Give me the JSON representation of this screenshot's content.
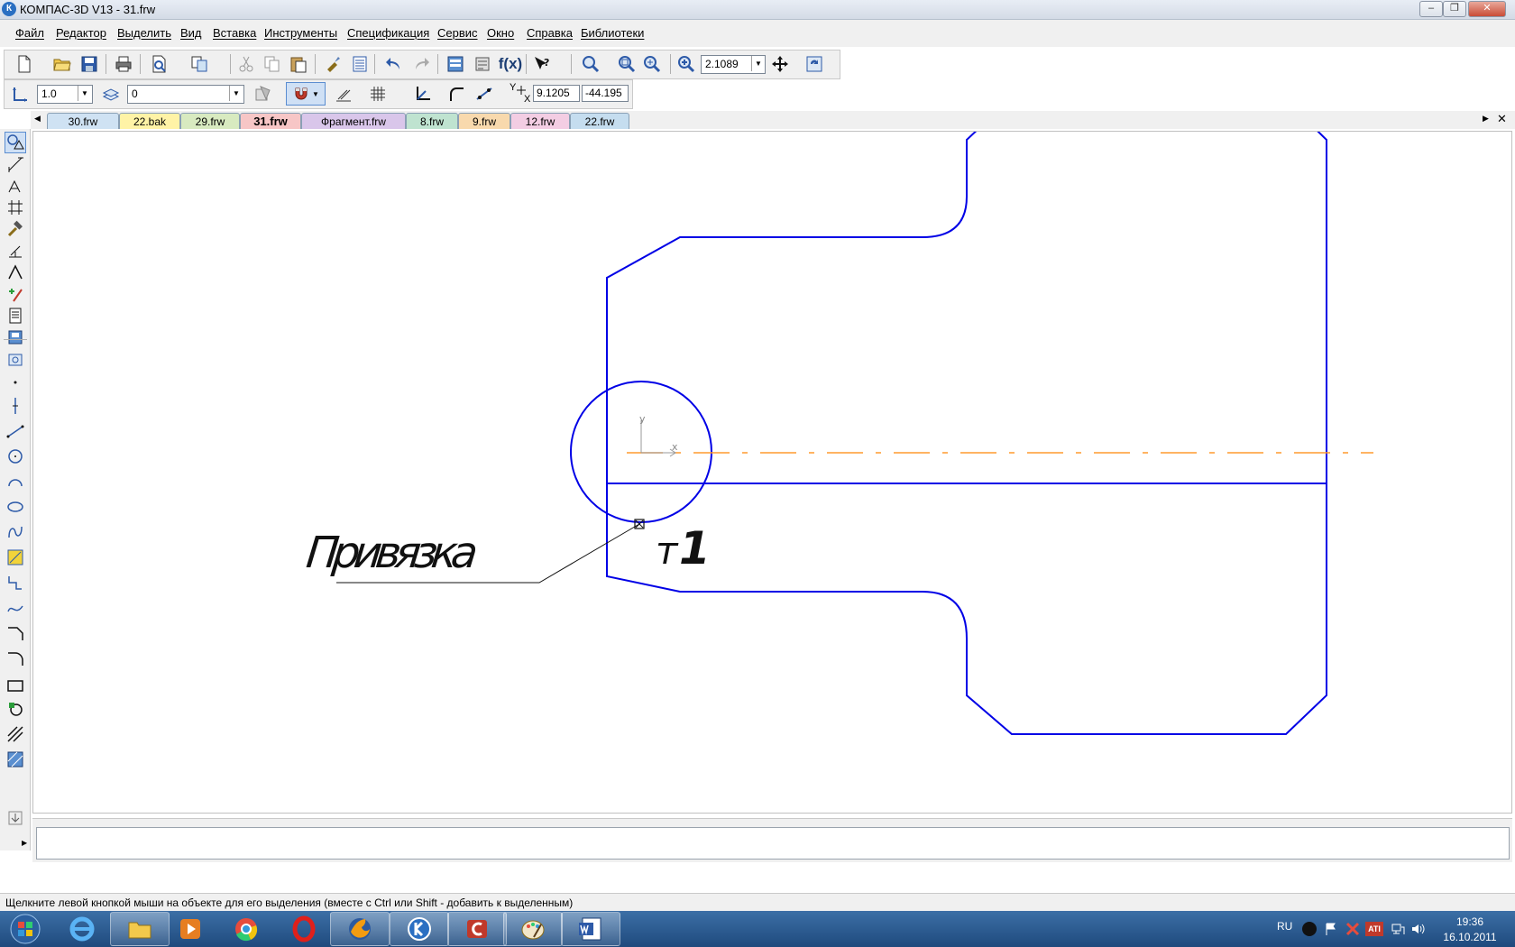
{
  "window": {
    "app_icon": "К",
    "title": "КОМПАС-3D V13 - 31.frw",
    "minimize_icon": "minimize-icon",
    "maximize_icon": "restore-icon",
    "close_icon": "close-icon"
  },
  "menu": {
    "items": [
      "Файл",
      "Редактор",
      "Выделить",
      "Вид",
      "Вставка",
      "Инструменты",
      "Спецификация",
      "Сервис",
      "Окно",
      "Справка",
      "Библиотеки"
    ]
  },
  "toolbar": {
    "zoom_value": "2.1089",
    "step_value": "1.0",
    "layer_value": "0",
    "coord_y_label": "Y",
    "coord_x_label": "X",
    "coord_x_value": "9.1205",
    "coord_y_value": "-44.195",
    "fx_label": "f(x)"
  },
  "tabs": [
    {
      "label": "30.frw",
      "color": "#cfe2f3",
      "active": false
    },
    {
      "label": "22.bak",
      "color": "#fff3a6",
      "active": false
    },
    {
      "label": "29.frw",
      "color": "#d8eac0",
      "active": false
    },
    {
      "label": "31.frw",
      "color": "#f7c6c6",
      "active": true
    },
    {
      "label": "Фрагмент.frw",
      "color": "#d9c6ea",
      "active": false
    },
    {
      "label": "8.frw",
      "color": "#bfe3d0",
      "active": false
    },
    {
      "label": "9.frw",
      "color": "#f8d9ad",
      "active": false
    },
    {
      "label": "12.frw",
      "color": "#f3cde3",
      "active": false
    },
    {
      "label": "22.frw",
      "color": "#c5ddef",
      "active": false
    }
  ],
  "drawing": {
    "leader_text": "Привязка",
    "point_label_t": "т",
    "point_label_n": "1",
    "axis_x": "x",
    "axis_y": "y",
    "geometry_color": "#0000e6",
    "centerline_color": "#ff9a2e"
  },
  "status": {
    "message": "Щелкните левой кнопкой мыши на объекте для его выделения (вместе с Ctrl или Shift - добавить к выделенным)"
  },
  "taskbar": {
    "language": "RU",
    "time": "19:36",
    "date": "16.10.2011"
  }
}
